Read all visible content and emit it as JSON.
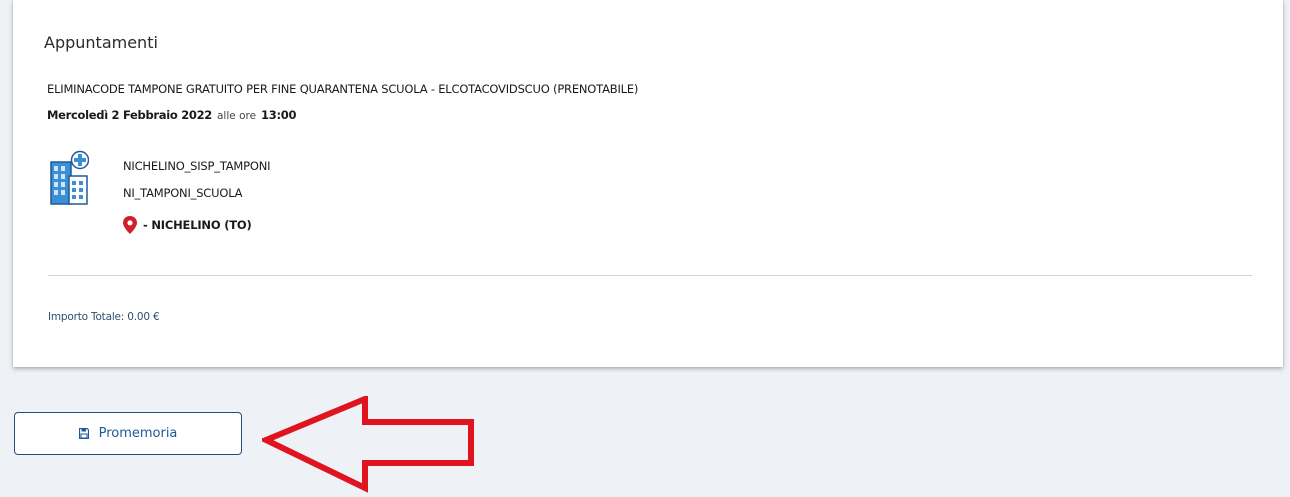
{
  "appointments": {
    "title": "Appuntamenti",
    "service": "ELIMINACODE TAMPONE GRATUITO PER FINE QUARANTENA SCUOLA - ELCOTACOVIDSCUO (PRENOTABILE)",
    "date": "Mercoledì 2 Febbraio 2022",
    "time_prefix": "alle ore",
    "time": "13:00",
    "location": {
      "facility": "NICHELINO_SISP_TAMPONI",
      "unit": "NI_TAMPONI_SCUOLA",
      "city": "- NICHELINO (TO)"
    },
    "total": "Importo Totale: 0.00 €"
  },
  "reminder_button": {
    "label": "Promemoria",
    "icon": "save-icon"
  },
  "icons": {
    "facility": "hospital-building-icon",
    "location": "map-pin-icon",
    "annotation": "red-arrow"
  },
  "colors": {
    "accent": "#1f5a96",
    "pin": "#d0202c",
    "arrow": "#e0141e",
    "background": "#eef1f5",
    "icon_blue": "#3b8fd6"
  }
}
